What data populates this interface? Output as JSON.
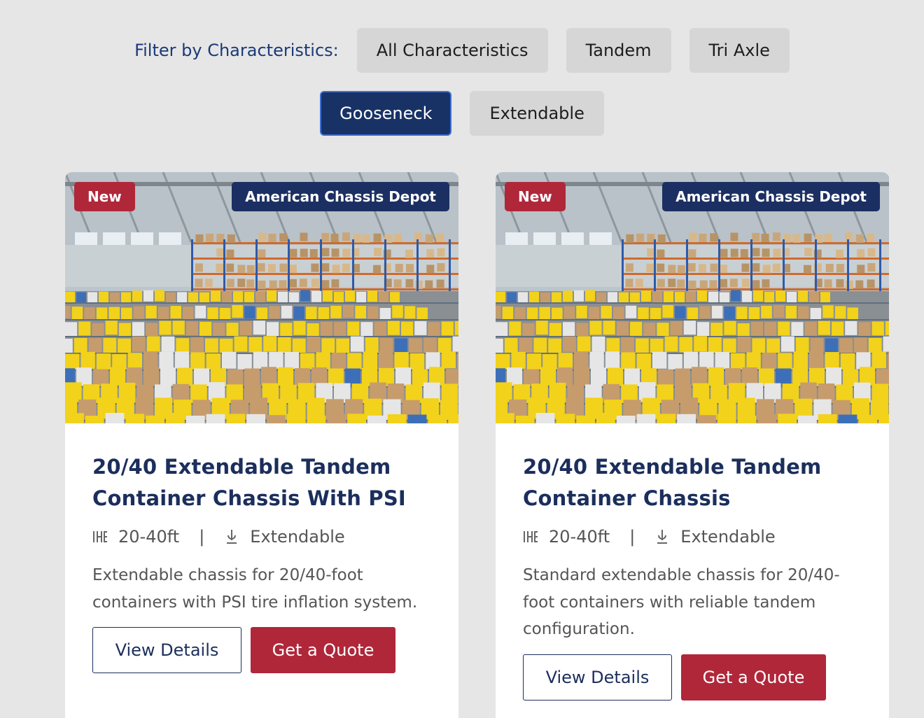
{
  "filter": {
    "label": "Filter by Characteristics:",
    "options": [
      "All Characteristics",
      "Tandem",
      "Tri Axle",
      "Gooseneck",
      "Extendable"
    ],
    "active": "Gooseneck",
    "active_color": "#183266",
    "chip_color": "#d6d6d6"
  },
  "cards": [
    {
      "badge": "New",
      "dealer": "American Chassis Depot",
      "image_alt": "warehouse",
      "title": "20/40 Extendable Tandem Container Chassis With PSI",
      "length": "20-40ft",
      "separator": "|",
      "type": "Extendable",
      "length_icon": "axle-icon",
      "type_icon": "extendable-icon",
      "description": "Extendable chassis for 20/40-foot containers with PSI tire inflation system.",
      "view_label": "View Details",
      "quote_label": "Get a Quote"
    },
    {
      "badge": "New",
      "dealer": "American Chassis Depot",
      "image_alt": "warehouse",
      "title": "20/40 Extendable Tandem Container Chassis",
      "length": "20-40ft",
      "separator": "|",
      "type": "Extendable",
      "length_icon": "axle-icon",
      "type_icon": "extendable-icon",
      "description": "Standard extendable chassis for 20/40-foot containers with reliable tandem configuration.",
      "view_label": "View Details",
      "quote_label": "Get a Quote"
    }
  ],
  "colors": {
    "brand_navy": "#1b2e5c",
    "brand_red": "#b0273a",
    "page_bg": "#e6e6e6"
  }
}
